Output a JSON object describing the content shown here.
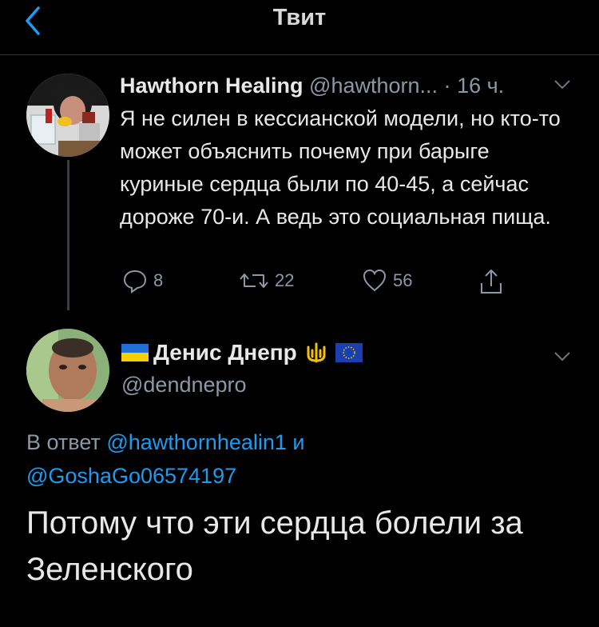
{
  "header": {
    "title": "Твит"
  },
  "parent_tweet": {
    "name": "Hawthorn Healing",
    "handle": "@hawthorn...",
    "separator": "·",
    "time": "16 ч.",
    "text": "Я не силен в кессианской модели, но кто-то может объяснить почему при барыге куриные сердца были по 40-45, а сейчас дороже 70-и. А ведь это социальная пища.",
    "counts": {
      "replies": "8",
      "retweets": "22",
      "likes": "56"
    }
  },
  "reply_tweet": {
    "name": "Денис Днепр",
    "handle": "@dendnepro",
    "replying_prefix": "В ответ",
    "mention1": "@hawthornhealin1",
    "conjunction": "и",
    "mention2": "@GoshaGo06574197",
    "text": "Потому что эти сердца болели за Зеленского"
  },
  "colors": {
    "background": "#000000",
    "text": "#e8e8e8",
    "secondary": "#8b98a5",
    "link": "#1d9bf0",
    "divider": "#2f3336"
  },
  "icons": [
    "back-chevron-icon",
    "caret-down-icon",
    "reply-icon",
    "retweet-icon",
    "like-icon",
    "share-icon",
    "ukraine-flag-icon",
    "trident-icon",
    "eu-flag-icon"
  ]
}
